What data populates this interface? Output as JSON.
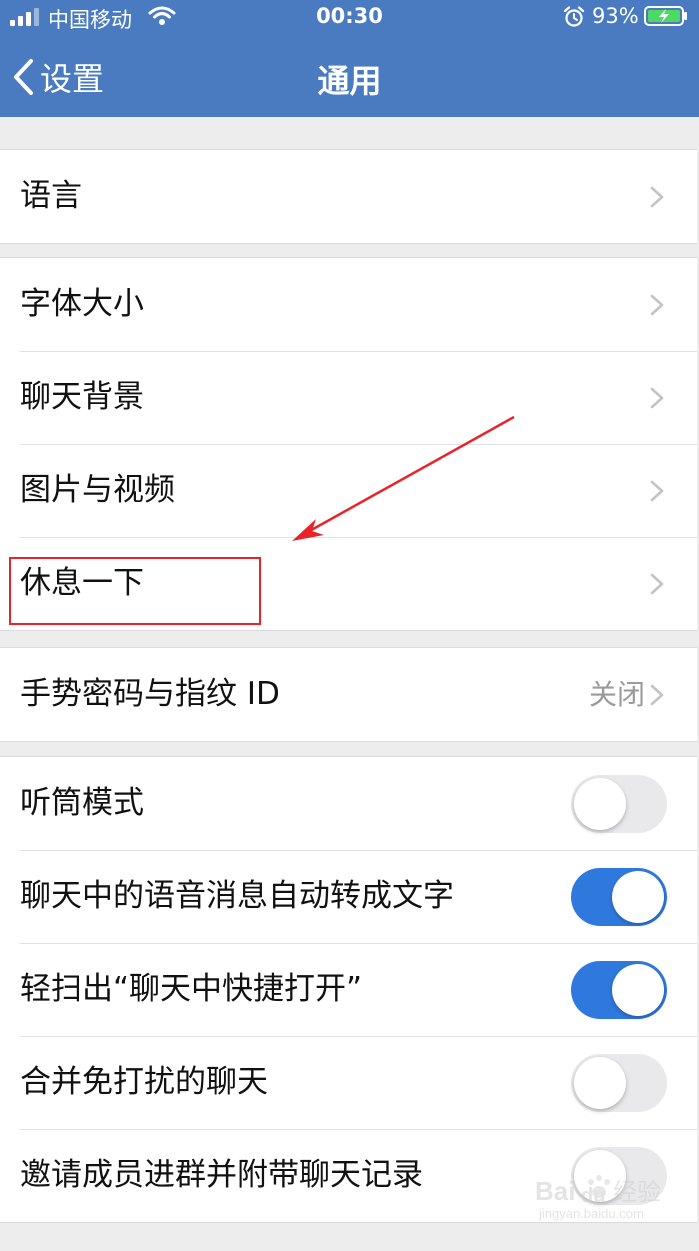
{
  "status_bar": {
    "carrier": "中国移动",
    "time": "00:30",
    "battery": "93%"
  },
  "nav": {
    "back_label": "设置",
    "title": "通用"
  },
  "groups": [
    {
      "rows": [
        {
          "label": "语言",
          "type": "link"
        }
      ]
    },
    {
      "rows": [
        {
          "label": "字体大小",
          "type": "link"
        },
        {
          "label": "聊天背景",
          "type": "link"
        },
        {
          "label": "图片与视频",
          "type": "link"
        },
        {
          "label": "休息一下",
          "type": "link",
          "highlighted": true
        }
      ]
    },
    {
      "rows": [
        {
          "label": "手势密码与指纹 ID",
          "type": "link",
          "value": "关闭"
        }
      ]
    },
    {
      "rows": [
        {
          "label": "听筒模式",
          "type": "toggle",
          "on": false
        },
        {
          "label": "聊天中的语音消息自动转成文字",
          "type": "toggle",
          "on": true
        },
        {
          "label": "轻扫出“聊天中快捷打开”",
          "type": "toggle",
          "on": true
        },
        {
          "label": "合并免打扰的聊天",
          "type": "toggle",
          "on": false
        },
        {
          "label": "邀请成员进群并附带聊天记录",
          "type": "toggle",
          "on": false
        }
      ]
    }
  ],
  "annotation": {
    "color": "#e8242b"
  },
  "watermark": {
    "brand": "Baidu经验",
    "url": "jingyan.baidu.com"
  },
  "colors": {
    "nav_bar": "#4a7bc0",
    "toggle_on": "#2f79de",
    "toggle_off": "#e9e9eb",
    "background": "#ededed"
  }
}
